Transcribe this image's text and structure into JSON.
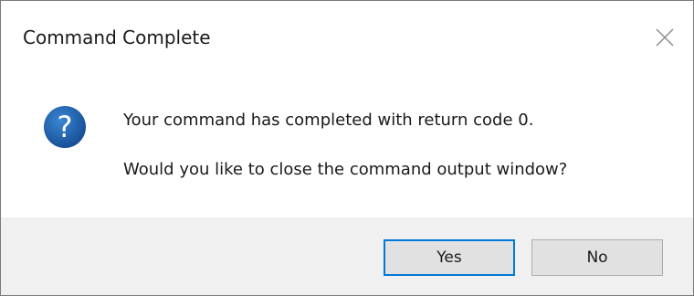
{
  "window": {
    "title": "Command Complete"
  },
  "message": {
    "line1": "Your command has completed with return code 0.",
    "line2": "Would you like to close the command output window?",
    "icon": "question-icon"
  },
  "buttons": {
    "yes_label": "Yes",
    "no_label": "No"
  },
  "colors": {
    "icon_blue": "#1a5fa8",
    "focus_border": "#0078d7",
    "footer_bg": "#f0f0f0",
    "button_bg": "#e1e1e1"
  }
}
